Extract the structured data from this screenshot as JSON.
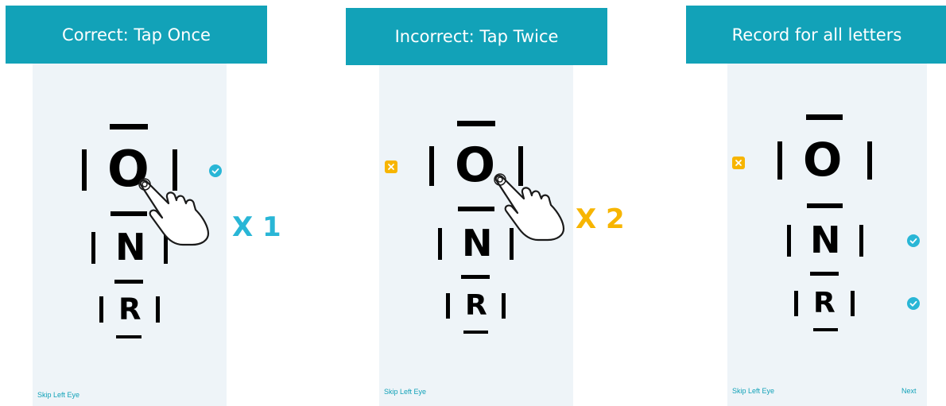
{
  "panels": [
    {
      "banner": "Correct: Tap Once",
      "skip_label": "Skip Left Eye",
      "chart": {
        "row1": "O",
        "row2": "N",
        "row3": "R"
      },
      "multiplier": "X 1",
      "mark": "check-icon"
    },
    {
      "banner": "Incorrect: Tap Twice",
      "skip_label": "Skip Left Eye",
      "chart": {
        "row1": "O",
        "row2": "N",
        "row3": "R"
      },
      "multiplier": "X 2",
      "mark": "x-icon"
    },
    {
      "banner": "Record for all letters",
      "skip_label": "Skip Left Eye",
      "next_label": "Next",
      "chart": {
        "row1": "O",
        "row2": "N",
        "row3": "R"
      },
      "marks": [
        "x-icon",
        "check-icon",
        "check-icon"
      ]
    }
  ],
  "colors": {
    "banner": "#12a2b8",
    "screen": "#eef4f8",
    "correct": "#29b6d6",
    "incorrect": "#f7b500"
  },
  "icons": [
    "tap-hand-icon",
    "check-icon",
    "x-icon"
  ]
}
